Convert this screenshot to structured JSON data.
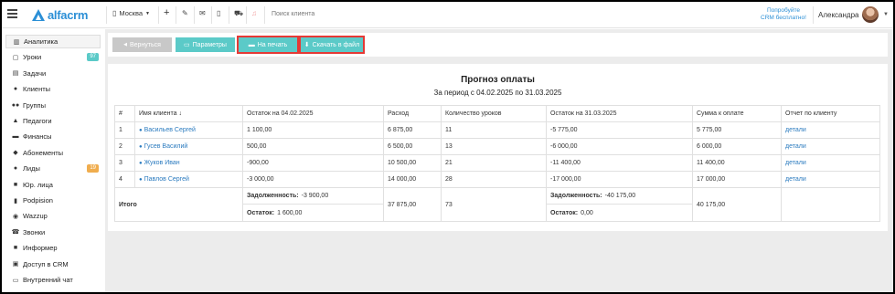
{
  "app": {
    "logo_text": "alfacrm"
  },
  "topbar": {
    "branch": "Москва",
    "search_placeholder": "Поиск клиента",
    "promo_line1": "Попробуйте",
    "promo_line2": "CRM бесплатно!",
    "user_name": "Александра"
  },
  "sidebar": {
    "items": [
      {
        "label": "Аналитика",
        "icon": "chart-icon",
        "glyph": "▥"
      },
      {
        "label": "Уроки",
        "icon": "calendar-icon",
        "glyph": "▢",
        "badge": "97",
        "badge_color": "#5bcac8"
      },
      {
        "label": "Задачи",
        "icon": "tasks-icon",
        "glyph": "▤"
      },
      {
        "label": "Клиенты",
        "icon": "user-icon",
        "glyph": "●"
      },
      {
        "label": "Группы",
        "icon": "users-icon",
        "glyph": "●●"
      },
      {
        "label": "Педагоги",
        "icon": "graduation-cap-icon",
        "glyph": "▲"
      },
      {
        "label": "Финансы",
        "icon": "money-icon",
        "glyph": "▬"
      },
      {
        "label": "Абонементы",
        "icon": "tag-icon",
        "glyph": "◆"
      },
      {
        "label": "Лиды",
        "icon": "user-plus-icon",
        "glyph": "●",
        "badge": "19",
        "badge_color": "#f0ad4e"
      },
      {
        "label": "Юр. лица",
        "icon": "briefcase-icon",
        "glyph": "■"
      },
      {
        "label": "Podpision",
        "icon": "file-icon",
        "glyph": "▮"
      },
      {
        "label": "Wazzup",
        "icon": "whatsapp-icon",
        "glyph": "◉"
      },
      {
        "label": "Звонки",
        "icon": "phone-icon",
        "glyph": "☎"
      },
      {
        "label": "Информер",
        "icon": "informer-icon",
        "glyph": "■"
      },
      {
        "label": "Доступ в CRM",
        "icon": "lock-icon",
        "glyph": "▣"
      },
      {
        "label": "Внутренний чат",
        "icon": "chat-icon",
        "glyph": "▭"
      }
    ]
  },
  "toolbar": {
    "back_label": "Вернуться",
    "params_label": "Параметры",
    "print_label": "На печать",
    "download_label": "Скачать в файл"
  },
  "report": {
    "title": "Прогноз оплаты",
    "subtitle": "За период с 04.02.2025 по 31.03.2025",
    "columns": [
      "#",
      "Имя клиента ↓",
      "Остаток на 04.02.2025",
      "Расход",
      "Количество уроков",
      "Остаток на 31.03.2025",
      "Сумма к оплате",
      "Отчет по клиенту"
    ],
    "rows": [
      {
        "n": "1",
        "name": "Васильев Сергей",
        "start": "1 100,00",
        "expense": "6 875,00",
        "lessons": "11",
        "end": "-5 775,00",
        "pay": "5 775,00",
        "link": "детали"
      },
      {
        "n": "2",
        "name": "Гусев Василий",
        "start": "500,00",
        "expense": "6 500,00",
        "lessons": "13",
        "end": "-6 000,00",
        "pay": "6 000,00",
        "link": "детали"
      },
      {
        "n": "3",
        "name": "Жуков Иван",
        "start": "-900,00",
        "expense": "10 500,00",
        "lessons": "21",
        "end": "-11 400,00",
        "pay": "11 400,00",
        "link": "детали"
      },
      {
        "n": "4",
        "name": "Павлов Сергей",
        "start": "-3 000,00",
        "expense": "14 000,00",
        "lessons": "28",
        "end": "-17 000,00",
        "pay": "17 000,00",
        "link": "детали"
      }
    ],
    "total": {
      "label": "Итого",
      "debt_label": "Задолженность:",
      "rest_label": "Остаток:",
      "start_debt": "-3 900,00",
      "start_rest": "1 600,00",
      "expense": "37 875,00",
      "lessons": "73",
      "end_debt": "-40 175,00",
      "end_rest": "0,00",
      "pay": "40 175,00"
    }
  }
}
